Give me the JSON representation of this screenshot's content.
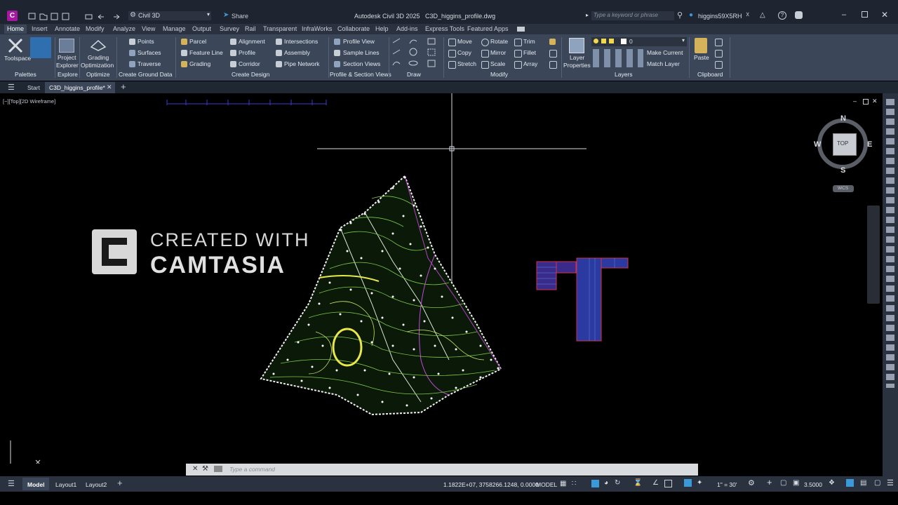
{
  "titlebar": {
    "app_letter": "C",
    "workspace": "Civil 3D",
    "share": "Share",
    "title": "Autodesk Civil 3D 2025   C3D_higgins_profile.dwg",
    "search_placeholder": "Type a keyword or phrase",
    "user": "higgins59X5RH"
  },
  "tabs": [
    "Home",
    "Insert",
    "Annotate",
    "Modify",
    "Analyze",
    "View",
    "Manage",
    "Output",
    "Survey",
    "Rail",
    "Transparent",
    "InfraWorks",
    "Collaborate",
    "Help",
    "Add-ins",
    "Express Tools",
    "Featured Apps"
  ],
  "ribbon": {
    "palettes": {
      "toolspace": "Toolspace",
      "title": "Palettes"
    },
    "explore": {
      "btn1": "Project",
      "btn2": "Explorer",
      "title": "Explore"
    },
    "optimize": {
      "btn1": "Grading",
      "btn2": "Optimization",
      "title": "Optimize"
    },
    "ground": {
      "points": "Points",
      "surfaces": "Surfaces",
      "traverse": "Traverse",
      "title": "Create Ground Data"
    },
    "design": {
      "parcel": "Parcel",
      "feature_line": "Feature Line",
      "grading": "Grading",
      "alignment": "Alignment",
      "profile": "Profile",
      "corridor": "Corridor",
      "intersections": "Intersections",
      "assembly": "Assembly",
      "pipe_network": "Pipe Network",
      "title": "Create Design"
    },
    "psv": {
      "profile_view": "Profile View",
      "sample_lines": "Sample Lines",
      "section_views": "Section Views",
      "title": "Profile & Section Views"
    },
    "draw": {
      "title": "Draw"
    },
    "modify": {
      "move": "Move",
      "copy": "Copy",
      "stretch": "Stretch",
      "rotate": "Rotate",
      "mirror": "Mirror",
      "scale": "Scale",
      "trim": "Trim",
      "fillet": "Fillet",
      "array": "Array",
      "title": "Modify"
    },
    "layers": {
      "props1": "Layer",
      "props2": "Properties",
      "current_layer": "0",
      "make_current": "Make Current",
      "match_layer": "Match Layer",
      "title": "Layers"
    },
    "clipboard": {
      "paste": "Paste",
      "title": "Clipboard"
    }
  },
  "filetabs": {
    "start": "Start",
    "file": "C3D_higgins_profile*"
  },
  "viewport": {
    "label": "[−][Top][2D Wireframe]",
    "watermark_line1": "CREATED WITH",
    "watermark_line2": "CAMTASIA",
    "viewcube": {
      "n": "N",
      "s": "S",
      "e": "E",
      "w": "W",
      "top": "TOP",
      "wcs": "WCS"
    },
    "ucs_y": "Y"
  },
  "cmdline": {
    "placeholder": "Type a command"
  },
  "statusbar": {
    "model_tab": "Model",
    "layout1": "Layout1",
    "layout2": "Layout2",
    "coords": "1.1822E+07, 3758266.1248, 0.0000",
    "space": "MODEL",
    "scale": "1\" = 30'",
    "lineweight": "3.5000"
  },
  "colors": {
    "ribbon": "#3b4658",
    "titlebar": "#1e2530",
    "viewport": "#000000",
    "accent": "#3a9ad9"
  }
}
